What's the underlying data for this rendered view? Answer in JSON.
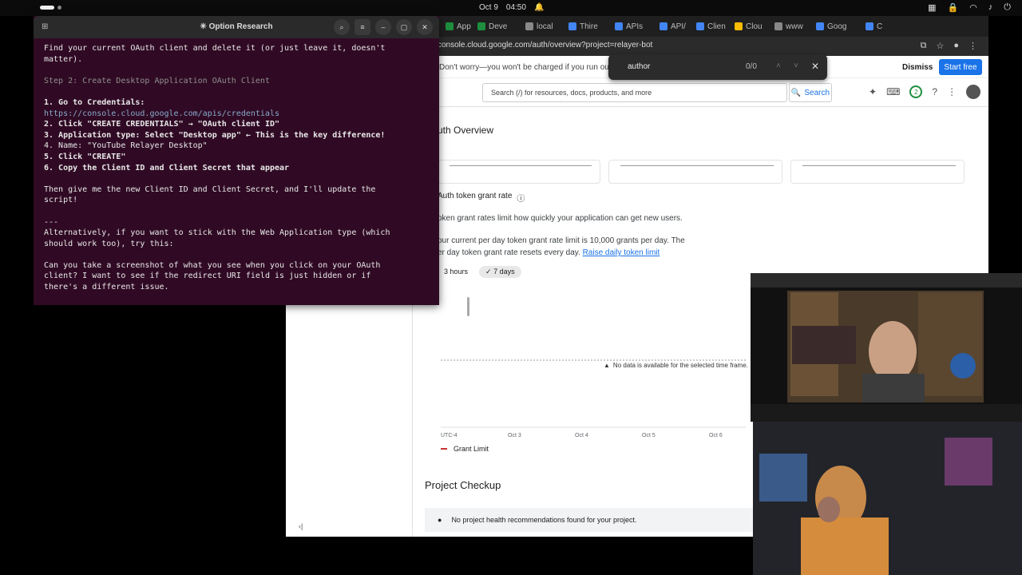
{
  "system": {
    "date": "Oct 9",
    "time": "04:50"
  },
  "terminal": {
    "title": "Option Research",
    "lines": [
      {
        "t": "Find your current OAuth client and delete it (or just leave it, doesn't",
        "c": ""
      },
      {
        "t": "matter).",
        "c": ""
      },
      {
        "t": "",
        "c": ""
      },
      {
        "t": "Step 2: Create Desktop Application OAuth Client",
        "c": "dim"
      },
      {
        "t": "",
        "c": ""
      },
      {
        "t": "1. Go to Credentials:",
        "c": "b"
      },
      {
        "t": "https://console.cloud.google.com/apis/credentials",
        "c": "url"
      },
      {
        "t": "2. Click \"CREATE CREDENTIALS\" → \"OAuth client ID\"",
        "c": "b"
      },
      {
        "t": "3. Application type: Select \"Desktop app\" ← This is the key difference!",
        "c": "b"
      },
      {
        "t": "4. Name: \"YouTube Relayer Desktop\"",
        "c": ""
      },
      {
        "t": "5. Click \"CREATE\"",
        "c": "b"
      },
      {
        "t": "6. Copy the Client ID and Client Secret that appear",
        "c": "b"
      },
      {
        "t": "",
        "c": ""
      },
      {
        "t": "Then give me the new Client ID and Client Secret, and I'll update the",
        "c": ""
      },
      {
        "t": "script!",
        "c": ""
      },
      {
        "t": "",
        "c": ""
      },
      {
        "t": "---",
        "c": ""
      },
      {
        "t": "Alternatively, if you want to stick with the Web Application type (which",
        "c": ""
      },
      {
        "t": "should work too), try this:",
        "c": ""
      },
      {
        "t": "",
        "c": ""
      },
      {
        "t": "Can you take a screenshot of what you see when you click on your OAuth",
        "c": ""
      },
      {
        "t": "client? I want to see if the redirect URI field is just hidden or if",
        "c": ""
      },
      {
        "t": "there's a different issue.",
        "c": ""
      }
    ]
  },
  "browser": {
    "tabs": [
      {
        "label": "App",
        "color": "#1e8e3e"
      },
      {
        "label": "Deve",
        "color": "#1e8e3e"
      },
      {
        "label": "local",
        "color": "#888"
      },
      {
        "label": "Thire",
        "color": "#4285f4"
      },
      {
        "label": "APIs",
        "color": "#4285f4"
      },
      {
        "label": "API/",
        "color": "#4285f4"
      },
      {
        "label": "Clien",
        "color": "#4285f4"
      },
      {
        "label": "Clou",
        "color": "#fbbc04"
      },
      {
        "label": "www",
        "color": "#888"
      },
      {
        "label": "Goog",
        "color": "#4285f4"
      },
      {
        "label": "C",
        "color": "#4285f4"
      }
    ],
    "url": "console.cloud.google.com/auth/overview?project=relayer-bot",
    "promo": "Don't worry—you won't be charged if you run out of cre",
    "dismiss": "Dismiss",
    "start_free": "Start free",
    "find": {
      "query": "author",
      "count": "0/0"
    },
    "search_placeholder": "Search (/) for resources, docs, products, and more",
    "search_button": "Search",
    "notif_count": "2"
  },
  "page": {
    "title": "uth Overview",
    "section_title": "Auth token grant rate",
    "desc1": "oken grant rates limit how quickly your application can get new users.",
    "desc2a": "our current per day token grant rate limit is 10,000 grants per day. The",
    "desc2b": "er day token grant rate resets every day.",
    "link": "Raise daily token limit",
    "chip1": "3 hours",
    "chip2": "7 days",
    "no_data": "No data is available for the selected time frame.",
    "legend": "Grant Limit",
    "checkup_title": "Project Checkup",
    "checkup_msg": "No project health recommendations found for your project."
  },
  "chart_data": {
    "type": "line",
    "x": [
      "UTC-4",
      "Oct 3",
      "Oct 4",
      "Oct 5",
      "Oct 6"
    ],
    "series": [
      {
        "name": "Grant Limit",
        "values": []
      }
    ],
    "title": "",
    "xlabel": "",
    "ylabel": ""
  },
  "colors": {
    "terminal_bg": "#300a24",
    "accent": "#1a73e8"
  }
}
